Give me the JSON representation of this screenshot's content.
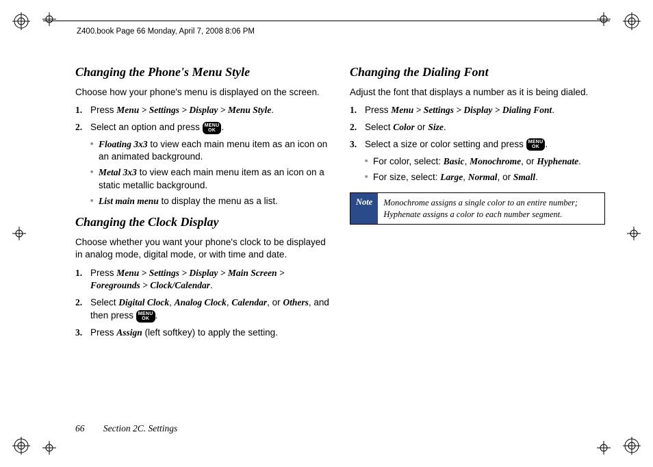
{
  "header": {
    "filename_line": "Z400.book  Page 66  Monday, April 7, 2008  8:06 PM"
  },
  "left": {
    "h1": "Changing the Phone's Menu Style",
    "intro": "Choose how your phone's menu is displayed on the screen.",
    "step1_pre": "Press ",
    "step1_path": "Menu > Settings > Display > Menu Style",
    "step2_pre": "Select an option and press ",
    "sub_a_b": "Floating 3x3",
    "sub_a_t": " to view each main menu item as an icon on an animated background.",
    "sub_b_b": "Metal 3x3",
    "sub_b_t": " to view each main menu item as an icon on a static metallic background.",
    "sub_c_b": "List main menu",
    "sub_c_t": " to display the menu as a list.",
    "h2": "Changing the Clock Display",
    "intro2": "Choose whether you want your phone's clock to be displayed in analog mode, digital mode, or with time and date.",
    "s2_1_pre": "Press ",
    "s2_1_path": "Menu > Settings > Display > Main Screen > Foregrounds > Clock/Calendar",
    "s2_2_pre": "Select ",
    "s2_2_o1": "Digital Clock",
    "s2_2_o2": "Analog Clock",
    "s2_2_o3": "Calendar",
    "s2_2_or": ", or ",
    "s2_2_o4": "Others",
    "s2_2_post": ", and then press ",
    "s2_3_pre": "Press ",
    "s2_3_b": "Assign",
    "s2_3_post": " (left softkey) to apply the setting."
  },
  "right": {
    "h1": "Changing the Dialing Font",
    "intro": "Adjust the font that displays a number as it is being dialed.",
    "step1_pre": "Press ",
    "step1_path": "Menu > Settings > Display > Dialing Font",
    "step2_pre": "Select ",
    "step2_o1": "Color",
    "step2_or": " or ",
    "step2_o2": "Size",
    "step3_pre": "Select a size or color setting and press ",
    "sub_a_pre": "For color, select: ",
    "sub_a_o1": "Basic",
    "sub_a_o2": "Monochrome",
    "sub_a_or": ", or ",
    "sub_a_o3": "Hyphenate",
    "sub_b_pre": "For size, select: ",
    "sub_b_o1": "Large",
    "sub_b_o2": "Normal",
    "sub_b_or": ", or ",
    "sub_b_o3": "Small",
    "note_label": "Note",
    "note_body": "Monochrome assigns a single color to an entire number; Hyphenate assigns a color to each number segment."
  },
  "footer": {
    "page_num": "66",
    "section": "Section 2C. Settings"
  },
  "common": {
    "period": ".",
    "comma": ", ",
    "menu_ok_top": "MENU",
    "menu_ok_bot": "OK",
    "n1": "1.",
    "n2": "2.",
    "n3": "3."
  }
}
